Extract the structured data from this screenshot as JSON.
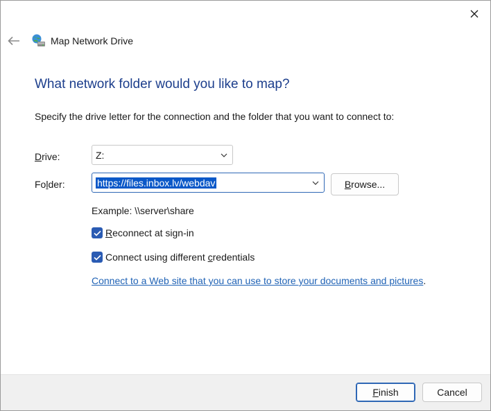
{
  "window": {
    "title": "Map Network Drive",
    "close_icon": "close-icon",
    "back_icon": "back-arrow-icon",
    "app_icon": "network-drive-icon"
  },
  "content": {
    "heading": "What network folder would you like to map?",
    "instructions": "Specify the drive letter for the connection and the folder that you want to connect to:",
    "drive": {
      "label_accel": "D",
      "label_rest": "rive:",
      "value": "Z:"
    },
    "folder": {
      "label_pre": "Fo",
      "label_accel": "l",
      "label_rest": "der:",
      "value": "https://files.inbox.lv/webdav"
    },
    "browse": {
      "accel": "B",
      "rest": "rowse..."
    },
    "example": "Example: \\\\server\\share",
    "reconnect": {
      "checked": true,
      "accel": "R",
      "rest": "econnect at sign-in"
    },
    "credentials": {
      "checked": true,
      "pre": "Connect using different ",
      "accel": "c",
      "rest": "redentials"
    },
    "link": {
      "text": "Connect to a Web site that you can use to store your documents and pictures",
      "suffix": "."
    }
  },
  "footer": {
    "finish": {
      "accel": "F",
      "rest": "inish"
    },
    "cancel": "Cancel"
  },
  "colors": {
    "heading": "#1c3e8c",
    "accent": "#2a5bb3",
    "link": "#1f62b5",
    "selection": "#0a58c8"
  }
}
